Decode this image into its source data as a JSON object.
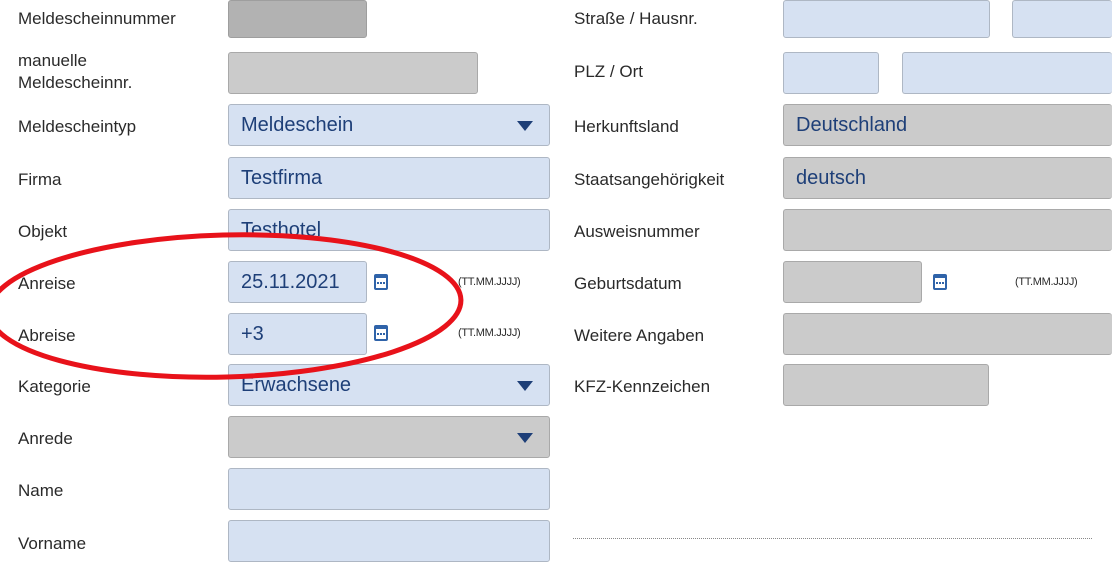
{
  "left": {
    "meldescheinnummer": "Meldescheinnummer",
    "manuelle": "manuelle Meldescheinnr.",
    "meldescheintyp": "Meldescheintyp",
    "meldescheintyp_value": "Meldeschein",
    "firma": "Firma",
    "firma_value": "Testfirma",
    "objekt": "Objekt",
    "objekt_value": "Testhotel",
    "anreise": "Anreise",
    "anreise_value": "25.11.2021",
    "abreise": "Abreise",
    "abreise_value": "+3",
    "kategorie": "Kategorie",
    "kategorie_value": "Erwachsene",
    "anrede": "Anrede",
    "name": "Name",
    "vorname": "Vorname"
  },
  "right": {
    "strasse": "Straße / Hausnr.",
    "plz": "PLZ / Ort",
    "herkunftsland": "Herkunftsland",
    "herkunftsland_value": "Deutschland",
    "staatsangehoerigkeit": "Staatsangehörigkeit",
    "staatsangehoerigkeit_value": "deutsch",
    "ausweisnummer": "Ausweisnummer",
    "geburtsdatum": "Geburtsdatum",
    "weitere": "Weitere Angaben",
    "kfz": "KFZ-Kennzeichen"
  },
  "date_format_hint": "(TT.MM.JJJJ)",
  "annotation_color": "#e8121a",
  "icons": [
    "calendar-icon",
    "chevron-down-icon"
  ]
}
